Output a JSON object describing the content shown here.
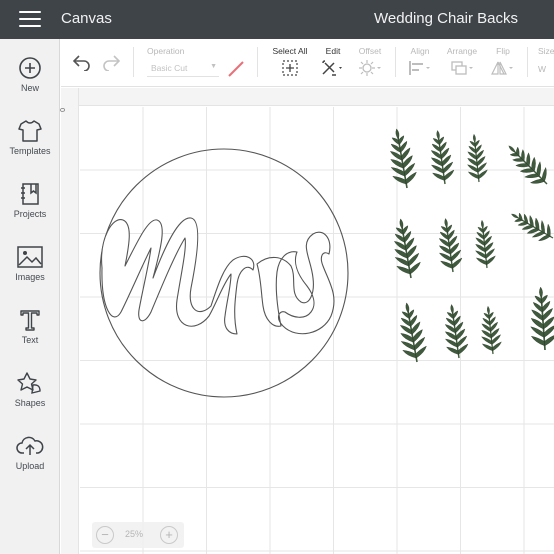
{
  "app": {
    "title": "Canvas",
    "project_name": "Wedding Chair Backs"
  },
  "sidebar": {
    "items": [
      {
        "label": "New",
        "icon": "plus-circle-icon"
      },
      {
        "label": "Templates",
        "icon": "shirt-icon"
      },
      {
        "label": "Projects",
        "icon": "notebook-icon"
      },
      {
        "label": "Images",
        "icon": "image-icon"
      },
      {
        "label": "Text",
        "icon": "text-t-icon"
      },
      {
        "label": "Shapes",
        "icon": "shapes-icon"
      },
      {
        "label": "Upload",
        "icon": "cloud-upload-icon"
      }
    ]
  },
  "toolbar": {
    "operation_label": "Operation",
    "operation_value": "Basic Cut",
    "select_all_label": "Select All",
    "edit_label": "Edit",
    "offset_label": "Offset",
    "align_label": "Align",
    "arrange_label": "Arrange",
    "flip_label": "Flip",
    "size_label": "Size",
    "size_w_label": "W",
    "colors": {
      "cut_swatch": "#e8707a",
      "enabled_text": "#333333",
      "disabled_text": "#b8b8b8"
    }
  },
  "canvas": {
    "ruler_origin": "0",
    "design_text": "Mrs",
    "leaf_color": "#3f5a3c",
    "leaf_highlight": "#8aa57a"
  },
  "zoom": {
    "minus": "−",
    "value": "25%",
    "plus": "+"
  }
}
